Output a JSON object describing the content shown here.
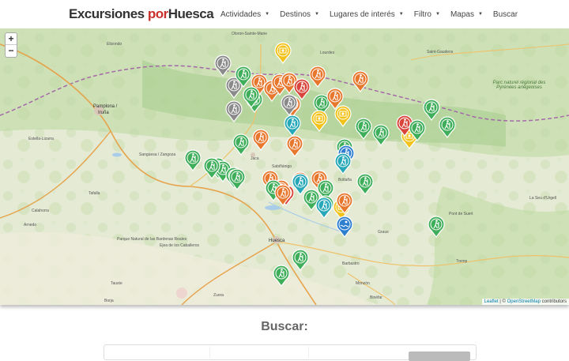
{
  "header": {
    "logo_main": "Excursiones ",
    "logo_por": "por",
    "logo_place": "Huesca",
    "nav": [
      {
        "label": "Actividades",
        "dropdown": true
      },
      {
        "label": "Destinos",
        "dropdown": true
      },
      {
        "label": "Lugares de interés",
        "dropdown": true
      },
      {
        "label": "Filtro",
        "dropdown": true
      },
      {
        "label": "Mapas",
        "dropdown": true
      },
      {
        "label": "Buscar",
        "dropdown": false
      }
    ]
  },
  "map": {
    "zoom_in": "+",
    "zoom_out": "−",
    "attribution_leaflet": "Leaflet",
    "attribution_sep": " | © ",
    "attribution_osm": "OpenStreetMap",
    "attribution_tail": " contributors",
    "places": [
      {
        "name": "Pamplona /",
        "cls": "big"
      },
      {
        "name": "Iruña",
        "cls": "big"
      },
      {
        "name": "Huesca",
        "cls": "big"
      },
      {
        "name": "Jaca",
        "cls": ""
      },
      {
        "name": "Sabiñánigo",
        "cls": ""
      },
      {
        "name": "Barbastro",
        "cls": ""
      },
      {
        "name": "Tremp",
        "cls": ""
      },
      {
        "name": "Graus",
        "cls": ""
      },
      {
        "name": "Boltaña",
        "cls": ""
      },
      {
        "name": "Ejea de los Caballeros",
        "cls": ""
      },
      {
        "name": "Sangüesa / Zangoza",
        "cls": ""
      },
      {
        "name": "Oloron-Sainte-Marie",
        "cls": ""
      },
      {
        "name": "Saint-Gaudens",
        "cls": ""
      },
      {
        "name": "Parc naturel régional des Pyrénées ariégeoises",
        "cls": "fr"
      },
      {
        "name": "Parque Natural de las Bardenas Reales",
        "cls": ""
      },
      {
        "name": "Tafalla",
        "cls": ""
      },
      {
        "name": "Estella-Lizarra",
        "cls": ""
      },
      {
        "name": "Monzón",
        "cls": ""
      },
      {
        "name": "Binéfar",
        "cls": ""
      },
      {
        "name": "Zuera",
        "cls": ""
      },
      {
        "name": "Tauste",
        "cls": ""
      },
      {
        "name": "Borja",
        "cls": ""
      },
      {
        "name": "Calahorra",
        "cls": ""
      },
      {
        "name": "Arnedo",
        "cls": ""
      },
      {
        "name": "Pont de Suert",
        "cls": ""
      },
      {
        "name": "La Seu d'Urgell",
        "cls": ""
      },
      {
        "name": "Lourdes",
        "cls": ""
      },
      {
        "name": "Elizondo",
        "cls": ""
      }
    ],
    "markers": [
      {
        "type": "gray",
        "icon": "hiker"
      },
      {
        "type": "gray",
        "icon": "hiker"
      },
      {
        "type": "gray",
        "icon": "hiker"
      },
      {
        "type": "yellow",
        "icon": "camera"
      },
      {
        "type": "green",
        "icon": "hiker"
      },
      {
        "type": "green",
        "icon": "hiker"
      },
      {
        "type": "orange",
        "icon": "hiker"
      },
      {
        "type": "orange",
        "icon": "hiker"
      },
      {
        "type": "green",
        "icon": "hiker"
      },
      {
        "type": "orange",
        "icon": "hiker"
      },
      {
        "type": "orange",
        "icon": "hiker"
      },
      {
        "type": "red",
        "icon": "hiker"
      },
      {
        "type": "orange",
        "icon": "hiker"
      },
      {
        "type": "gray",
        "icon": "hiker"
      },
      {
        "type": "orange",
        "icon": "hiker"
      },
      {
        "type": "green",
        "icon": "hiker"
      },
      {
        "type": "orange",
        "icon": "hiker"
      },
      {
        "type": "orange",
        "icon": "hiker"
      },
      {
        "type": "yellow",
        "icon": "camera"
      },
      {
        "type": "cyan",
        "icon": "hiker"
      },
      {
        "type": "green",
        "icon": "hiker"
      },
      {
        "type": "yellow",
        "icon": "camera"
      },
      {
        "type": "green",
        "icon": "hiker"
      },
      {
        "type": "green",
        "icon": "hiker"
      },
      {
        "type": "green",
        "icon": "hiker"
      },
      {
        "type": "orange",
        "icon": "hiker"
      },
      {
        "type": "green",
        "icon": "hiker"
      },
      {
        "type": "blue",
        "icon": "hiker"
      },
      {
        "type": "cyan",
        "icon": "hiker"
      },
      {
        "type": "orange",
        "icon": "hiker"
      },
      {
        "type": "green",
        "icon": "hiker"
      },
      {
        "type": "green",
        "icon": "hiker"
      },
      {
        "type": "green",
        "icon": "hiker"
      },
      {
        "type": "green",
        "icon": "hiker"
      },
      {
        "type": "orange",
        "icon": "hiker"
      },
      {
        "type": "orange",
        "icon": "hiker"
      },
      {
        "type": "red",
        "icon": "hiker"
      },
      {
        "type": "orange",
        "icon": "hiker"
      },
      {
        "type": "green",
        "icon": "hiker"
      },
      {
        "type": "cyan",
        "icon": "hiker"
      },
      {
        "type": "orange",
        "icon": "hiker"
      },
      {
        "type": "green",
        "icon": "hiker"
      },
      {
        "type": "green",
        "icon": "hiker"
      },
      {
        "type": "green",
        "icon": "hiker"
      },
      {
        "type": "cyan",
        "icon": "hiker"
      },
      {
        "type": "yellow",
        "icon": "camera"
      },
      {
        "type": "orange",
        "icon": "hiker"
      },
      {
        "type": "blue",
        "icon": "swim"
      },
      {
        "type": "green",
        "icon": "hiker"
      },
      {
        "type": "orange",
        "icon": "hiker"
      },
      {
        "type": "green",
        "icon": "hiker"
      },
      {
        "type": "green",
        "icon": "hiker"
      },
      {
        "type": "yellow",
        "icon": "camera"
      },
      {
        "type": "red",
        "icon": "hiker"
      },
      {
        "type": "green",
        "icon": "hiker"
      },
      {
        "type": "green",
        "icon": "hiker"
      },
      {
        "type": "green",
        "icon": "hiker"
      },
      {
        "type": "green",
        "icon": "hiker"
      },
      {
        "type": "green",
        "icon": "hiker"
      }
    ],
    "colors": {
      "green": "#3fae5a",
      "orange": "#e8772e",
      "gray": "#8a8a8a",
      "yellow": "#f2c21a",
      "cyan": "#27a8b8",
      "red": "#d9453a",
      "blue": "#2f7fd0"
    }
  },
  "search": {
    "title": "Buscar:"
  }
}
